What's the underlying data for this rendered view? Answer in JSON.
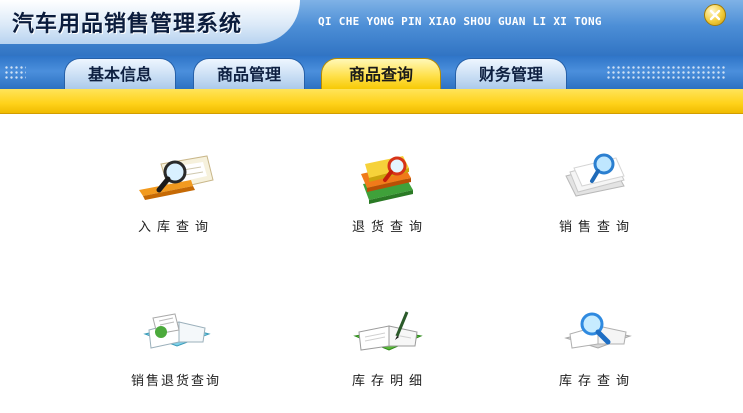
{
  "header": {
    "title": "汽车用品销售管理系统",
    "pinyin": "QI CHE YONG PIN XIAO SHOU GUAN LI XI TONG"
  },
  "nav": {
    "tabs": [
      {
        "label": "基本信息",
        "active": false
      },
      {
        "label": "商品管理",
        "active": false
      },
      {
        "label": "商品查询",
        "active": true
      },
      {
        "label": "财务管理",
        "active": false
      }
    ]
  },
  "grid": {
    "items": [
      {
        "label": "入库查询",
        "icon": "magnifier-document-icon"
      },
      {
        "label": "退货查询",
        "icon": "books-magnifier-icon"
      },
      {
        "label": "销售查询",
        "icon": "papers-magnifier-icon"
      },
      {
        "label": "销售退货查询",
        "icon": "open-book-notes-icon"
      },
      {
        "label": "库存明细",
        "icon": "notebook-pen-icon"
      },
      {
        "label": "库存查询",
        "icon": "open-book-magnifier-icon"
      }
    ]
  },
  "colors": {
    "header_blue": "#4c8ed6",
    "tab_active": "#ffd21a",
    "tab_inactive": "#c6dcf3"
  }
}
